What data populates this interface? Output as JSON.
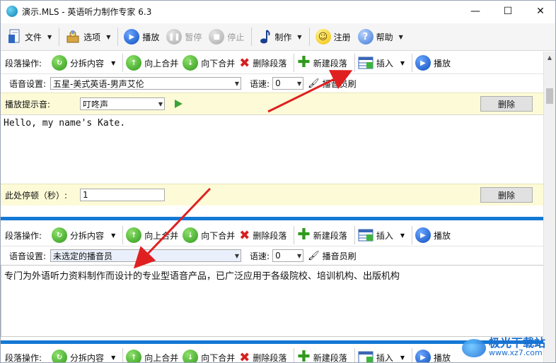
{
  "window": {
    "title": "演示.MLS - 英语听力制作专家 6.3",
    "controls": [
      "—",
      "☐",
      "✕"
    ]
  },
  "toolbar": {
    "file": "文件",
    "options": "选项",
    "play": "播放",
    "pause": "暂停",
    "stop": "停止",
    "make": "制作",
    "register": "注册",
    "help": "帮助"
  },
  "segment": {
    "label": "段落操作:",
    "split": "分拆内容",
    "merge_up": "向上合并",
    "merge_down": "向下合并",
    "delete": "删除段落",
    "new": "新建段落",
    "insert": "插入",
    "play": "播放"
  },
  "voice": {
    "label": "语音设置:",
    "speed_label": "语速:",
    "speed_value": "0",
    "brush_label": "播音员刷"
  },
  "seg1": {
    "voice_value": "五星-美式英语-男声艾伦",
    "prompt_label": "播放提示音:",
    "prompt_value": "叮咚声",
    "delete_btn": "删除",
    "text": "Hello, my name's Kate.",
    "pause_label": "此处停顿（秒）:",
    "pause_value": "1",
    "delete_btn2": "删除"
  },
  "seg2": {
    "voice_value": "未选定的播音员",
    "text": "专门为外语听力资料制作而设计的专业型语音产品，已广泛应用于各级院校、培训机构、出版机构"
  },
  "watermark": {
    "big": "极光下载站",
    "small": "www.xz7.com"
  },
  "colors": {
    "accent_blue": "#1479d4",
    "arrow_red": "#e02020",
    "yellow_bg": "#fdfbd7"
  }
}
